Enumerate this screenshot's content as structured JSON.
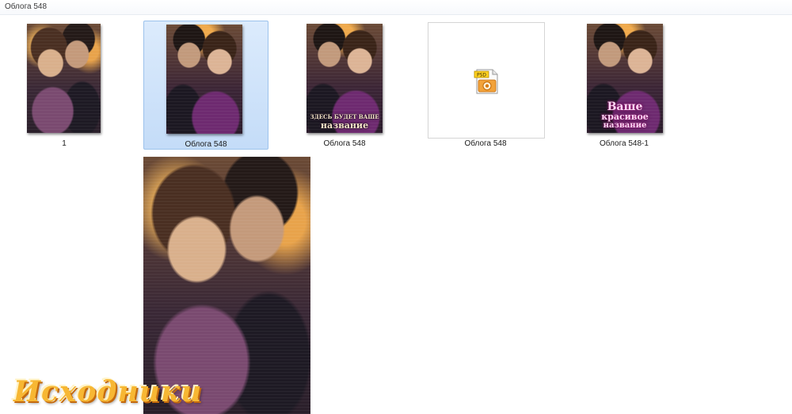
{
  "window": {
    "title": "Облога 548"
  },
  "files": [
    {
      "name": "1",
      "type": "image"
    },
    {
      "name": "Облога  548",
      "type": "image",
      "selected": true
    },
    {
      "name": "Облога 548",
      "type": "image",
      "cover_text": [
        "ЗДЕСЬ БУДЕТ ВАШЕ",
        "название"
      ]
    },
    {
      "name": "Облога 548",
      "type": "psd",
      "icon": "psd-file-icon",
      "badge": "PSD"
    },
    {
      "name": "Облога 548-1",
      "type": "image",
      "cover_text": [
        "Ваше",
        "красивое",
        "название"
      ]
    }
  ],
  "watermark": "Исходники",
  "colors": {
    "selection": "#cde3fb",
    "selection_border": "#9cc2ec",
    "watermark": "#f7b733"
  }
}
